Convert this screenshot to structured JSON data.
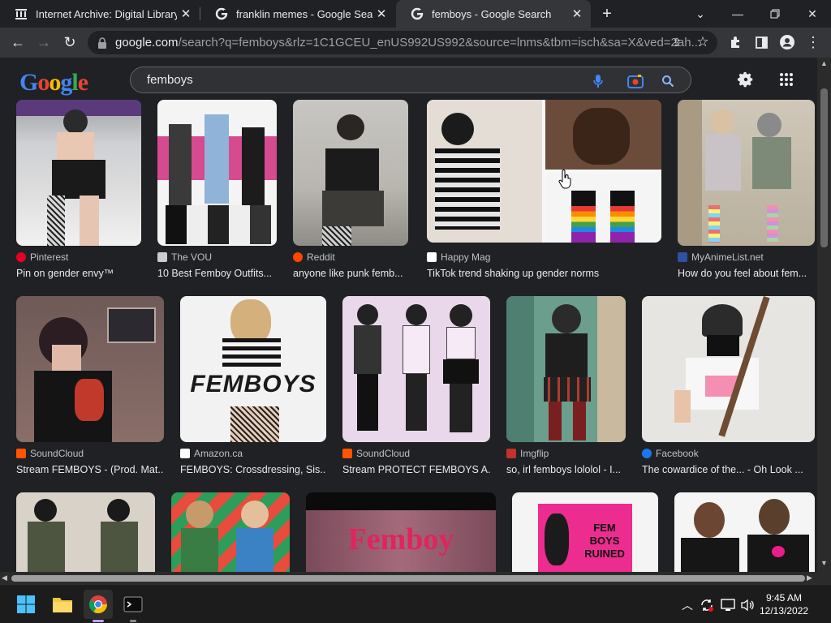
{
  "tabs": [
    {
      "title": "Internet Archive: Digital Library o"
    },
    {
      "title": "franklin memes - Google Search"
    },
    {
      "title": "femboys - Google Search"
    }
  ],
  "address": {
    "host": "google.com",
    "path": "/search?q=femboys&rlz=1C1GCEU_enUS992US992&source=lnms&tbm=isch&sa=X&ved=2ah..."
  },
  "search": {
    "query": "femboys"
  },
  "logo": "Google",
  "results": [
    {
      "source": "Pinterest",
      "caption": "Pin on gender envy™",
      "color": "#e60023"
    },
    {
      "source": "The VOU",
      "caption": "10 Best Femboy Outfits...",
      "color": "#cccccc"
    },
    {
      "source": "Reddit",
      "caption": "anyone like punk femb...",
      "color": "#ff4500"
    },
    {
      "source": "Happy Mag",
      "caption": "TikTok trend shaking up gender norms",
      "color": "#ffffff"
    },
    {
      "source": "MyAnimeList.net",
      "caption": "How do you feel about fem...",
      "color": "#2e51a2"
    },
    {
      "source": "SoundCloud",
      "caption": "Stream FEMBOYS - (Prod. Mat...",
      "color": "#ff5500"
    },
    {
      "source": "Amazon.ca",
      "caption": "FEMBOYS: Crossdressing, Sis...",
      "color": "#ffffff"
    },
    {
      "source": "SoundCloud",
      "caption": "Stream PROTECT FEMBOYS A...",
      "color": "#ff5500"
    },
    {
      "source": "Imgflip",
      "caption": "so, irl femboys lololol - I...",
      "color": "#c4302b"
    },
    {
      "source": "Facebook",
      "caption": "The cowardice of the... - Oh Look ...",
      "color": "#1877f2"
    }
  ],
  "image_text": {
    "femboys_cover": "FEMBOYS",
    "femboy_banner": "Femboy",
    "fem_boys_ruined": "FEM BOYS RUINED"
  },
  "clock": {
    "time": "9:45 AM",
    "date": "12/13/2022"
  }
}
